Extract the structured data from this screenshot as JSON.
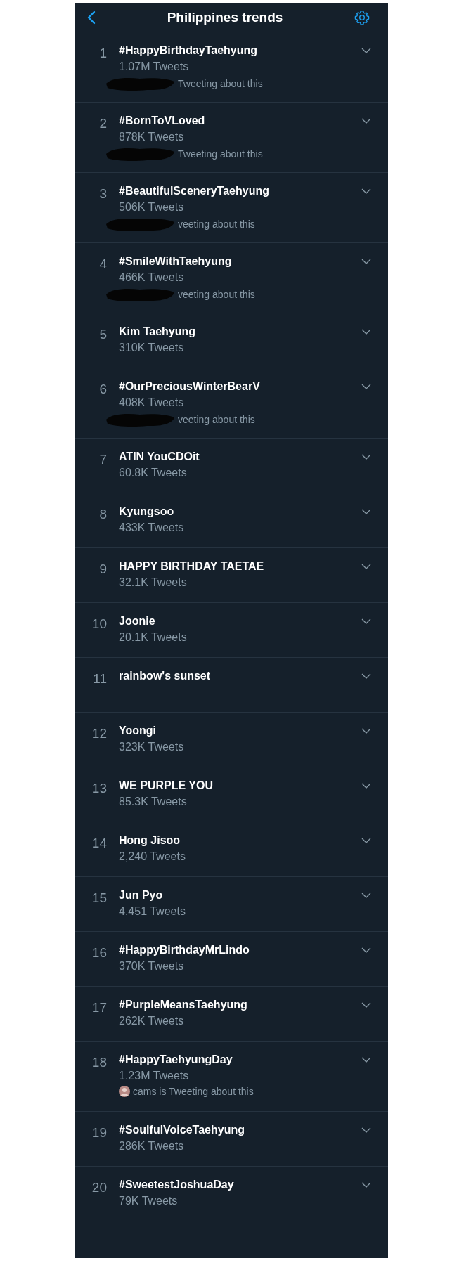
{
  "header": {
    "title": "Philippines trends"
  },
  "trends": [
    {
      "rank": "1",
      "name": "#HappyBirthdayTaehyung",
      "count": "1.07M Tweets",
      "context": {
        "kind": "redacted",
        "text": "Tweeting about this"
      }
    },
    {
      "rank": "2",
      "name": "#BornToVLoved",
      "count": "878K Tweets",
      "context": {
        "kind": "redacted",
        "text": "Tweeting about this"
      }
    },
    {
      "rank": "3",
      "name": "#BeautifulSceneryTaehyung",
      "count": "506K Tweets",
      "context": {
        "kind": "redacted",
        "text": "veeting about this"
      }
    },
    {
      "rank": "4",
      "name": "#SmileWithTaehyung",
      "count": "466K Tweets",
      "context": {
        "kind": "redacted",
        "text": "veeting about this"
      }
    },
    {
      "rank": "5",
      "name": "Kim Taehyung",
      "count": "310K Tweets"
    },
    {
      "rank": "6",
      "name": "#OurPreciousWinterBearV",
      "count": "408K Tweets",
      "context": {
        "kind": "redacted",
        "text": "veeting about this"
      }
    },
    {
      "rank": "7",
      "name": "ATIN YouCDOit",
      "count": "60.8K Tweets"
    },
    {
      "rank": "8",
      "name": "Kyungsoo",
      "count": "433K Tweets"
    },
    {
      "rank": "9",
      "name": "HAPPY BIRTHDAY TAETAE",
      "count": "32.1K Tweets"
    },
    {
      "rank": "10",
      "name": "Joonie",
      "count": "20.1K Tweets"
    },
    {
      "rank": "11",
      "name": "rainbow's sunset"
    },
    {
      "rank": "12",
      "name": "Yoongi",
      "count": "323K Tweets"
    },
    {
      "rank": "13",
      "name": "WE PURPLE YOU",
      "count": "85.3K Tweets"
    },
    {
      "rank": "14",
      "name": "Hong Jisoo",
      "count": "2,240 Tweets"
    },
    {
      "rank": "15",
      "name": "Jun Pyo",
      "count": "4,451 Tweets"
    },
    {
      "rank": "16",
      "name": "#HappyBirthdayMrLindo",
      "count": "370K Tweets"
    },
    {
      "rank": "17",
      "name": "#PurpleMeansTaehyung",
      "count": "262K Tweets"
    },
    {
      "rank": "18",
      "name": "#HappyTaehyungDay",
      "count": "1.23M Tweets",
      "context": {
        "kind": "avatar",
        "text": "cams is Tweeting about this"
      }
    },
    {
      "rank": "19",
      "name": "#SoulfulVoiceTaehyung",
      "count": "286K Tweets"
    },
    {
      "rank": "20",
      "name": "#SweetestJoshuaDay",
      "count": "79K Tweets"
    }
  ]
}
